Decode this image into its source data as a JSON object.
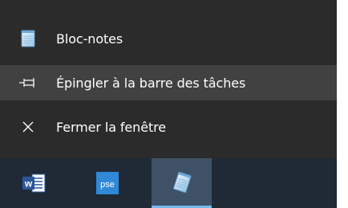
{
  "jump_list": {
    "app_name": "Bloc-notes",
    "pin_label": "Épingler à la barre des tâches",
    "close_label": "Fermer la fenêtre"
  },
  "taskbar": {
    "word_badge": "w",
    "pse_badge": "pse"
  },
  "colors": {
    "menu_bg": "#2b2b2b",
    "hover_bg": "#414141",
    "taskbar_bg": "#1f2a36",
    "active_button_bg": "#3f5166",
    "word_blue": "#2b579a",
    "pse_blue": "#2f89d6"
  },
  "icons": {
    "app": "notepad-icon",
    "pin": "pin-icon",
    "close": "close-icon",
    "taskbar": [
      "word-icon",
      "photoshop-elements-icon",
      "notepad-icon"
    ]
  }
}
